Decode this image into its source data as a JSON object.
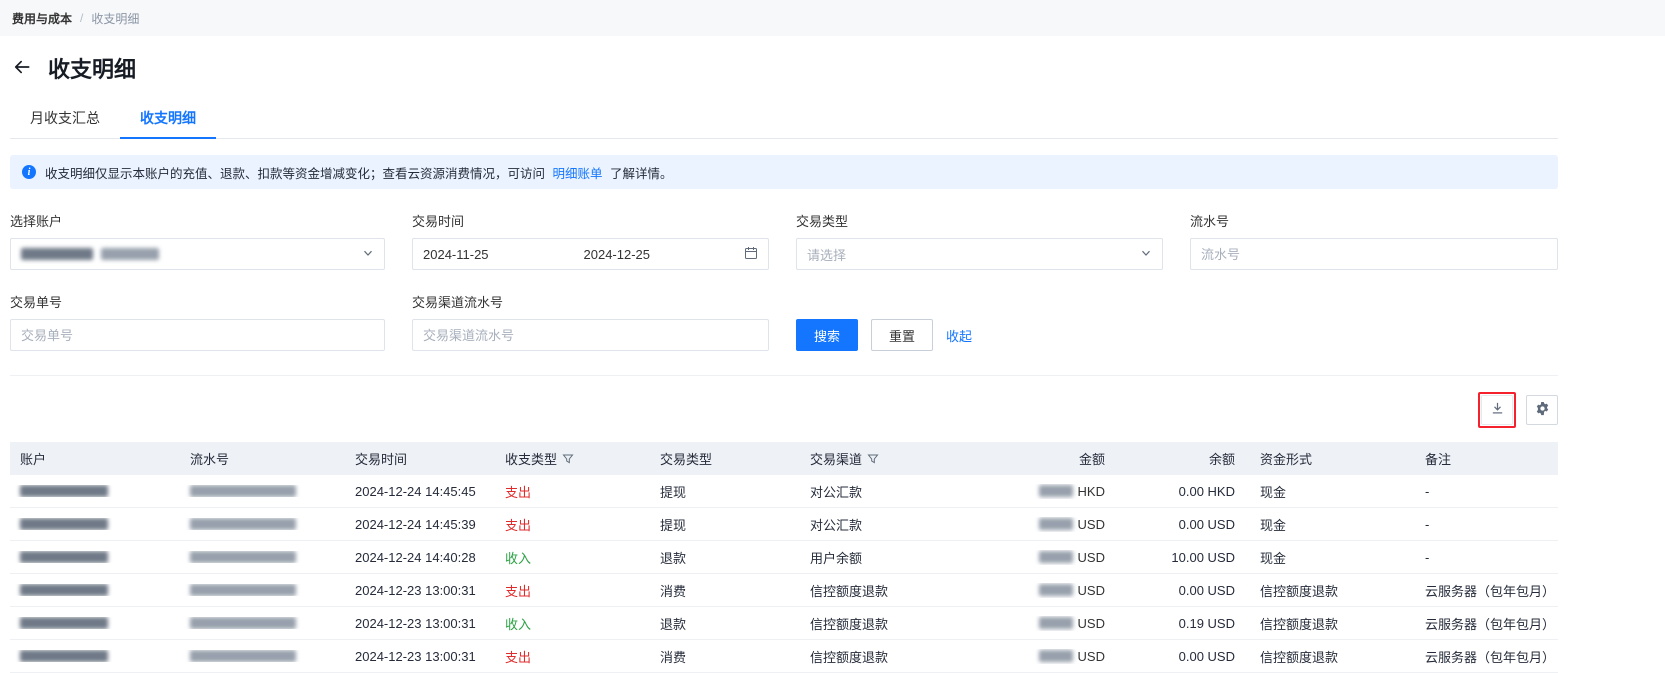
{
  "breadcrumb": {
    "items": [
      "费用与成本",
      "收支明细"
    ],
    "separator": "/"
  },
  "page": {
    "title": "收支明细"
  },
  "tabs": {
    "items": [
      {
        "label": "月收支汇总",
        "active": false
      },
      {
        "label": "收支明细",
        "active": true
      }
    ]
  },
  "banner": {
    "text_before_link": "收支明细仅显示本账户的充值、退款、扣款等资金增减变化；查看云资源消费情况，可访问",
    "link_text": "明细账单",
    "text_after_link": "了解详情。"
  },
  "filters": {
    "account": {
      "label": "选择账户"
    },
    "time": {
      "label": "交易时间",
      "start_date": "2024-11-25",
      "end_date": "2024-12-25"
    },
    "transaction_type": {
      "label": "交易类型",
      "placeholder": "请选择"
    },
    "serial_no": {
      "label": "流水号",
      "placeholder": "流水号"
    },
    "order_no": {
      "label": "交易单号",
      "placeholder": "交易单号"
    },
    "channel_serial_no": {
      "label": "交易渠道流水号",
      "placeholder": "交易渠道流水号"
    },
    "buttons": {
      "search": "搜索",
      "reset": "重置",
      "collapse": "收起"
    }
  },
  "table": {
    "headers": [
      "账户",
      "流水号",
      "交易时间",
      "收支类型",
      "交易类型",
      "交易渠道",
      "金额",
      "余额",
      "资金形式",
      "备注"
    ],
    "rows": [
      {
        "time": "2024-12-24 14:45:45",
        "io": "支出",
        "direction": "out",
        "type": "提现",
        "channel": "对公汇款",
        "amount_currency": "HKD",
        "balance": "0.00 HKD",
        "fund_form": "现金",
        "remark": "-"
      },
      {
        "time": "2024-12-24 14:45:39",
        "io": "支出",
        "direction": "out",
        "type": "提现",
        "channel": "对公汇款",
        "amount_currency": "USD",
        "balance": "0.00 USD",
        "fund_form": "现金",
        "remark": "-"
      },
      {
        "time": "2024-12-24 14:40:28",
        "io": "收入",
        "direction": "in",
        "type": "退款",
        "channel": "用户余额",
        "amount_currency": "USD",
        "balance": "10.00 USD",
        "fund_form": "现金",
        "remark": "-"
      },
      {
        "time": "2024-12-23 13:00:31",
        "io": "支出",
        "direction": "out",
        "type": "消费",
        "channel": "信控额度退款",
        "amount_currency": "USD",
        "balance": "0.00 USD",
        "fund_form": "信控额度退款",
        "remark": "云服务器（包年包月）"
      },
      {
        "time": "2024-12-23 13:00:31",
        "io": "收入",
        "direction": "in",
        "type": "退款",
        "channel": "信控额度退款",
        "amount_currency": "USD",
        "balance": "0.19 USD",
        "fund_form": "信控额度退款",
        "remark": "云服务器（包年包月）"
      },
      {
        "time": "2024-12-23 13:00:31",
        "io": "支出",
        "direction": "out",
        "type": "消费",
        "channel": "信控额度退款",
        "amount_currency": "USD",
        "balance": "0.00 USD",
        "fund_form": "信控额度退款",
        "remark": "云服务器（包年包月）"
      }
    ]
  },
  "colors": {
    "accent_blue": "#1476ff",
    "expense_red": "#e02b2b",
    "income_green": "#2ba143",
    "banner_bg": "#eaf3ff",
    "table_header_bg": "#eef1f6",
    "highlight_red": "#f5222d"
  }
}
